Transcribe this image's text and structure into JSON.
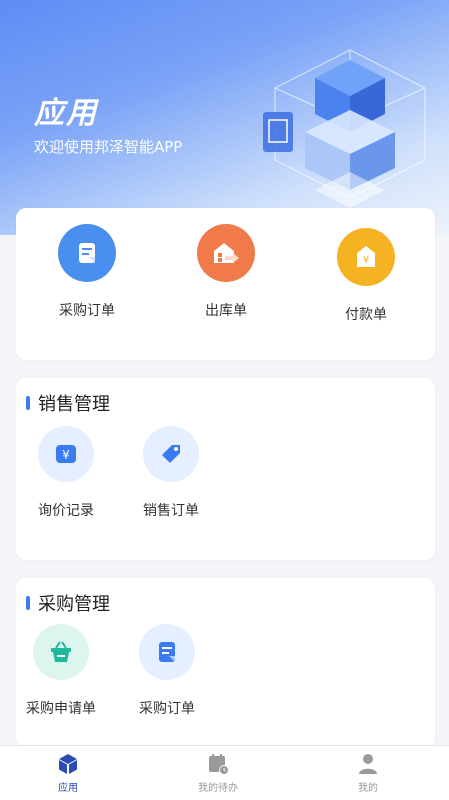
{
  "header": {
    "title": "应用",
    "subtitle": "欢迎使用邦泽智能APP"
  },
  "quick_actions": [
    {
      "label": "采购订单",
      "icon": "order-icon",
      "color": "#4a8ef0"
    },
    {
      "label": "出库单",
      "icon": "warehouse-out-icon",
      "color": "#f07a4a"
    },
    {
      "label": "付款单",
      "icon": "payment-icon",
      "color": "#f5b324"
    }
  ],
  "sections": {
    "sales": {
      "title": "销售管理",
      "items": [
        {
          "label": "询价记录",
          "icon": "yen-icon"
        },
        {
          "label": "销售订单",
          "icon": "tag-icon"
        }
      ]
    },
    "purchase": {
      "title": "采购管理",
      "items": [
        {
          "label": "采购申请单",
          "icon": "basket-icon"
        },
        {
          "label": "采购订单",
          "icon": "purchase-order-icon"
        }
      ]
    }
  },
  "tabbar": {
    "items": [
      {
        "label": "应用",
        "icon": "cube-icon",
        "active": true
      },
      {
        "label": "我的待办",
        "icon": "calendar-clock-icon",
        "active": false
      },
      {
        "label": "我的",
        "icon": "user-icon",
        "active": false
      }
    ]
  },
  "colors": {
    "accent": "#3a7bf2",
    "active_tab": "#2b4bb5"
  }
}
